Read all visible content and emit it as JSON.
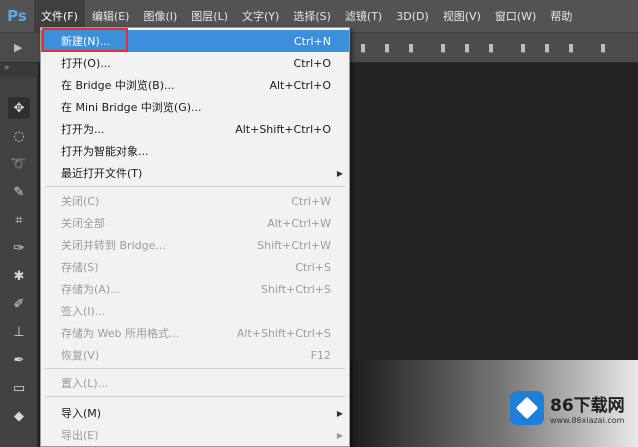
{
  "app": {
    "logo": "Ps"
  },
  "menubar": {
    "items": [
      "文件(F)",
      "编辑(E)",
      "图像(I)",
      "图层(L)",
      "文字(Y)",
      "选择(S)",
      "滤镜(T)",
      "3D(D)",
      "视图(V)",
      "窗口(W)",
      "帮助"
    ]
  },
  "tabstrip": {
    "label": "»"
  },
  "dropdown": {
    "items": [
      {
        "label": "新建(N)...",
        "shortcut": "Ctrl+N"
      },
      {
        "label": "打开(O)...",
        "shortcut": "Ctrl+O"
      },
      {
        "label": "在 Bridge 中浏览(B)...",
        "shortcut": "Alt+Ctrl+O"
      },
      {
        "label": "在 Mini Bridge 中浏览(G)...",
        "shortcut": ""
      },
      {
        "label": "打开为...",
        "shortcut": "Alt+Shift+Ctrl+O"
      },
      {
        "label": "打开为智能对象...",
        "shortcut": ""
      },
      {
        "label": "最近打开文件(T)",
        "shortcut": ""
      },
      {
        "label": "关闭(C)",
        "shortcut": "Ctrl+W"
      },
      {
        "label": "关闭全部",
        "shortcut": "Alt+Ctrl+W"
      },
      {
        "label": "关闭并转到 Bridge...",
        "shortcut": "Shift+Ctrl+W"
      },
      {
        "label": "存储(S)",
        "shortcut": "Ctrl+S"
      },
      {
        "label": "存储为(A)...",
        "shortcut": "Shift+Ctrl+S"
      },
      {
        "label": "签入(I)...",
        "shortcut": ""
      },
      {
        "label": "存储为 Web 所用格式...",
        "shortcut": "Alt+Shift+Ctrl+S"
      },
      {
        "label": "恢复(V)",
        "shortcut": "F12"
      },
      {
        "label": "置入(L)...",
        "shortcut": ""
      },
      {
        "label": "导入(M)",
        "shortcut": ""
      },
      {
        "label": "导出(E)",
        "shortcut": ""
      }
    ]
  },
  "watermark": {
    "main": "86下载网",
    "sub": "www.86xiazai.com"
  },
  "colors": {
    "highlight": "#3c8fdb",
    "annotation_box": "#e23030",
    "watermark_icon": "#1e7fd8"
  }
}
